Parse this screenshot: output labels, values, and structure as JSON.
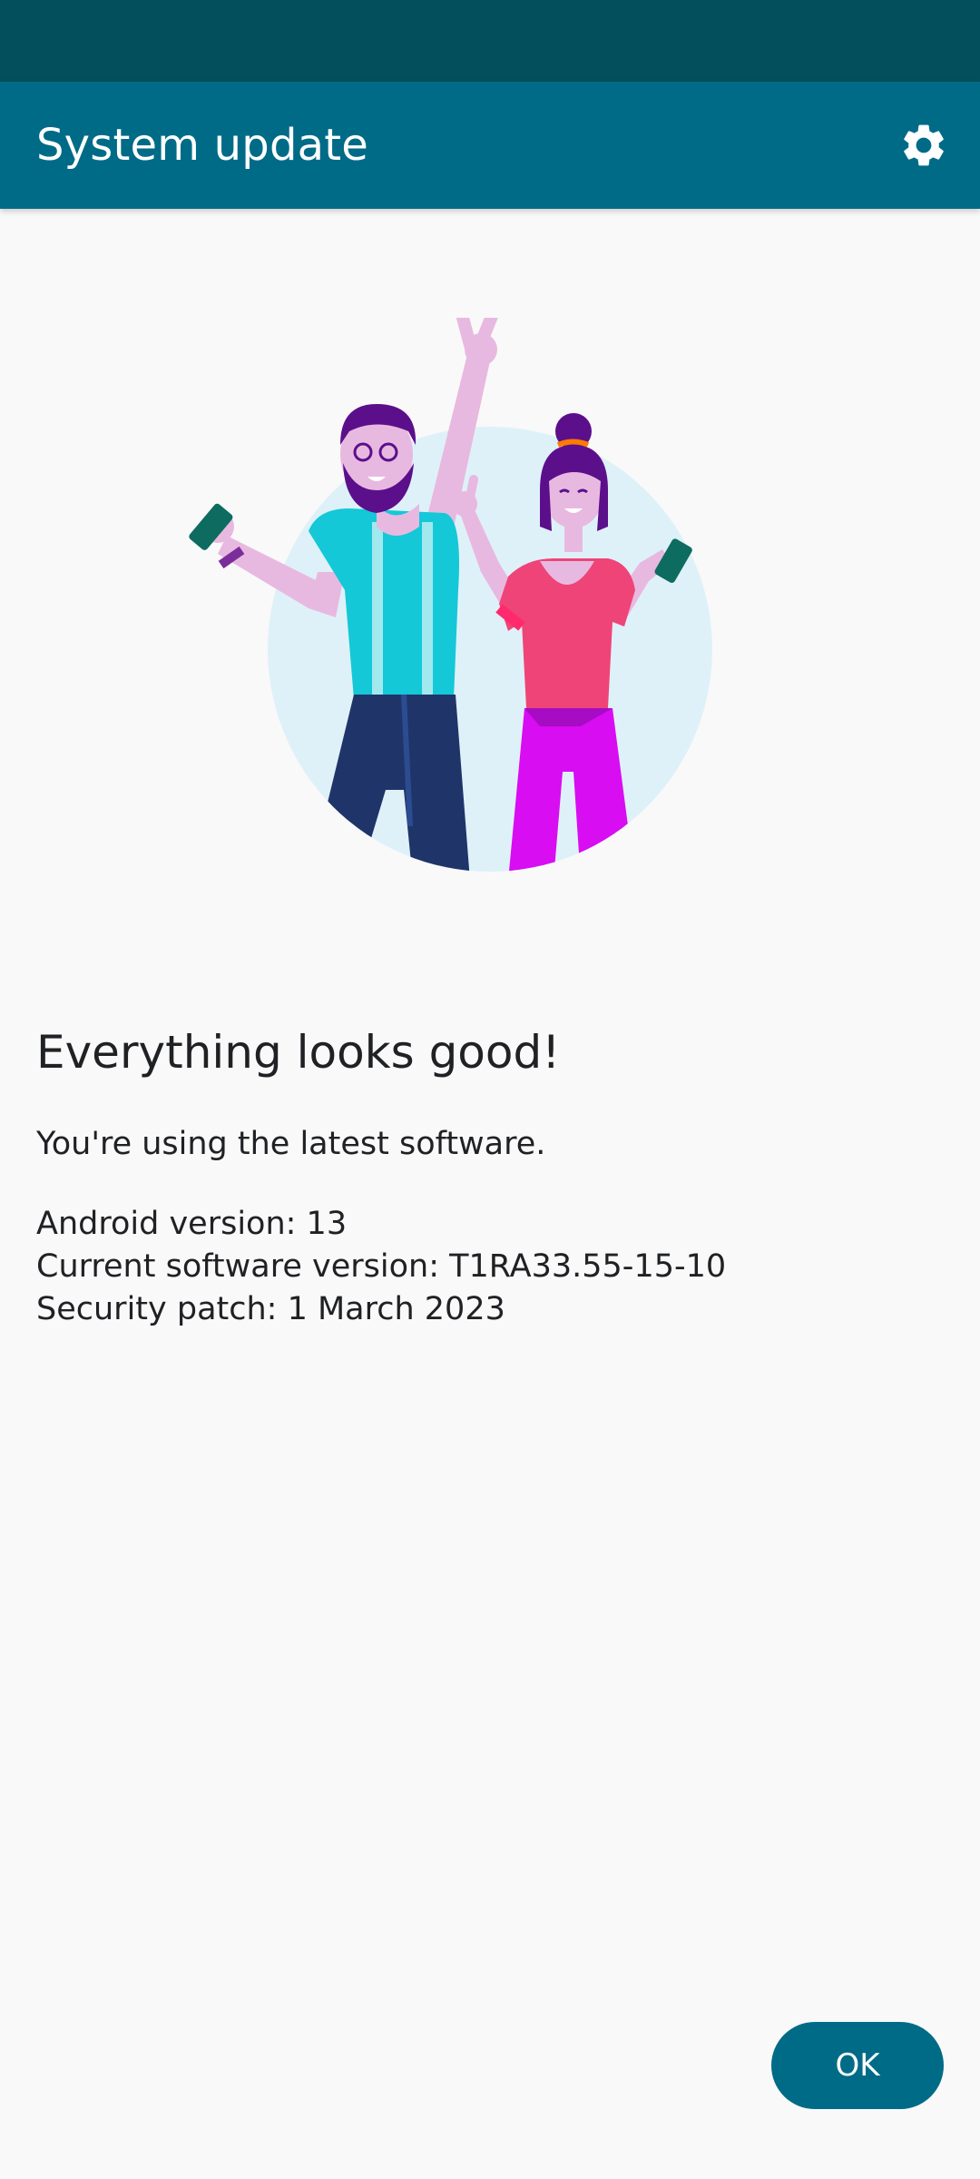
{
  "app_bar": {
    "title": "System update",
    "settings_icon": "gear-icon"
  },
  "colors": {
    "status_bar": "#034f5c",
    "app_bar": "#006b87",
    "background": "#f9f9f9",
    "button": "#006b87"
  },
  "illustration": {
    "icon": "celebrating-people-illustration"
  },
  "main": {
    "headline": "Everything looks good!",
    "subtext": "You're using the latest software.",
    "info": {
      "android_version": "Android version: 13",
      "software_version": "Current software version: T1RA33.55-15-10",
      "security_patch": "Security patch: 1 March 2023"
    }
  },
  "actions": {
    "ok_label": "OK"
  }
}
